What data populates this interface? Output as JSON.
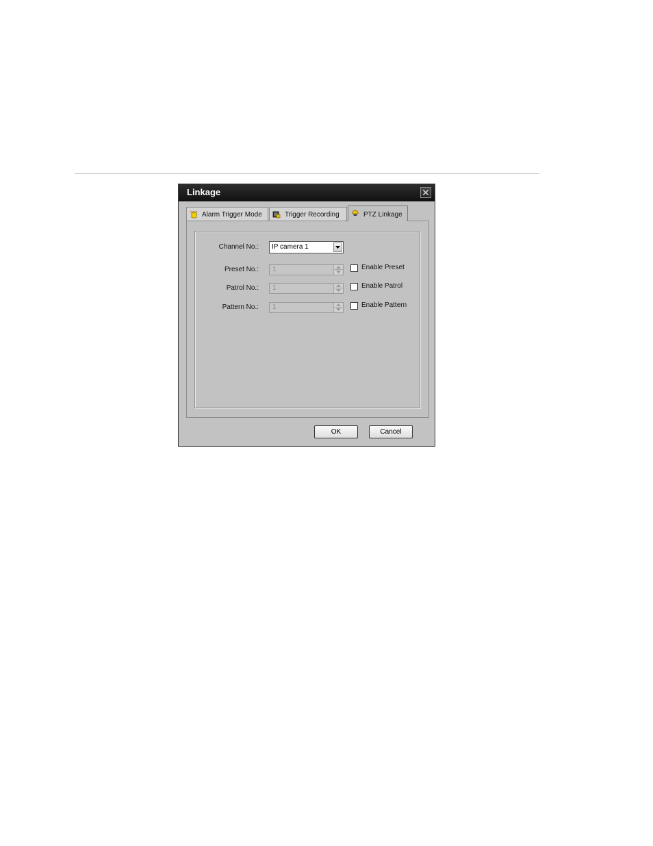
{
  "dialog": {
    "title": "Linkage"
  },
  "tabs": [
    {
      "label": "Alarm Trigger Mode",
      "icon": "alarm-hand-icon",
      "active": false
    },
    {
      "label": "Trigger Recording",
      "icon": "record-icon",
      "active": false
    },
    {
      "label": "PTZ Linkage",
      "icon": "ptz-icon",
      "active": true
    }
  ],
  "ptz": {
    "channel_label": "Channel No.:",
    "channel_value": "IP camera 1",
    "preset_label": "Preset No.:",
    "preset_value": "1",
    "preset_check_label": "Enable Preset",
    "patrol_label": "Patrol No.:",
    "patrol_value": "1",
    "patrol_check_label": "Enable Patrol",
    "pattern_label": "Pattern No.:",
    "pattern_value": "1",
    "pattern_check_label": "Enable Pattern"
  },
  "buttons": {
    "ok_label": "OK",
    "cancel_label": "Cancel"
  },
  "colors": {
    "titlebar": "#1a1a1a",
    "dialog_bg": "#c2c2c2",
    "ptz_icon": "#f2c200"
  }
}
